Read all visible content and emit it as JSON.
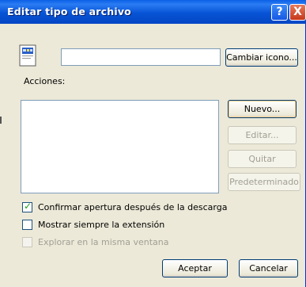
{
  "window": {
    "title": "Editar tipo de archivo"
  },
  "titlebar": {
    "help_glyph": "?",
    "close_glyph": "X"
  },
  "icon": {
    "name": "file-type-icon"
  },
  "file_type": {
    "name_value": ""
  },
  "buttons": {
    "change_icon": "Cambiar icono...",
    "new": "Nuevo...",
    "edit": "Editar...",
    "remove": "Quitar",
    "default": "Predeterminado",
    "ok": "Aceptar",
    "cancel": "Cancelar"
  },
  "actions": {
    "label": "Acciones:",
    "items": []
  },
  "options": {
    "confirm_open": {
      "label": "Confirmar apertura después de la descarga",
      "checked": true
    },
    "always_show_ext": {
      "label": "Mostrar siempre la extensión",
      "checked": false
    },
    "browse_same_window": {
      "label": "Explorar en la misma ventana",
      "checked": false,
      "enabled": false
    }
  }
}
